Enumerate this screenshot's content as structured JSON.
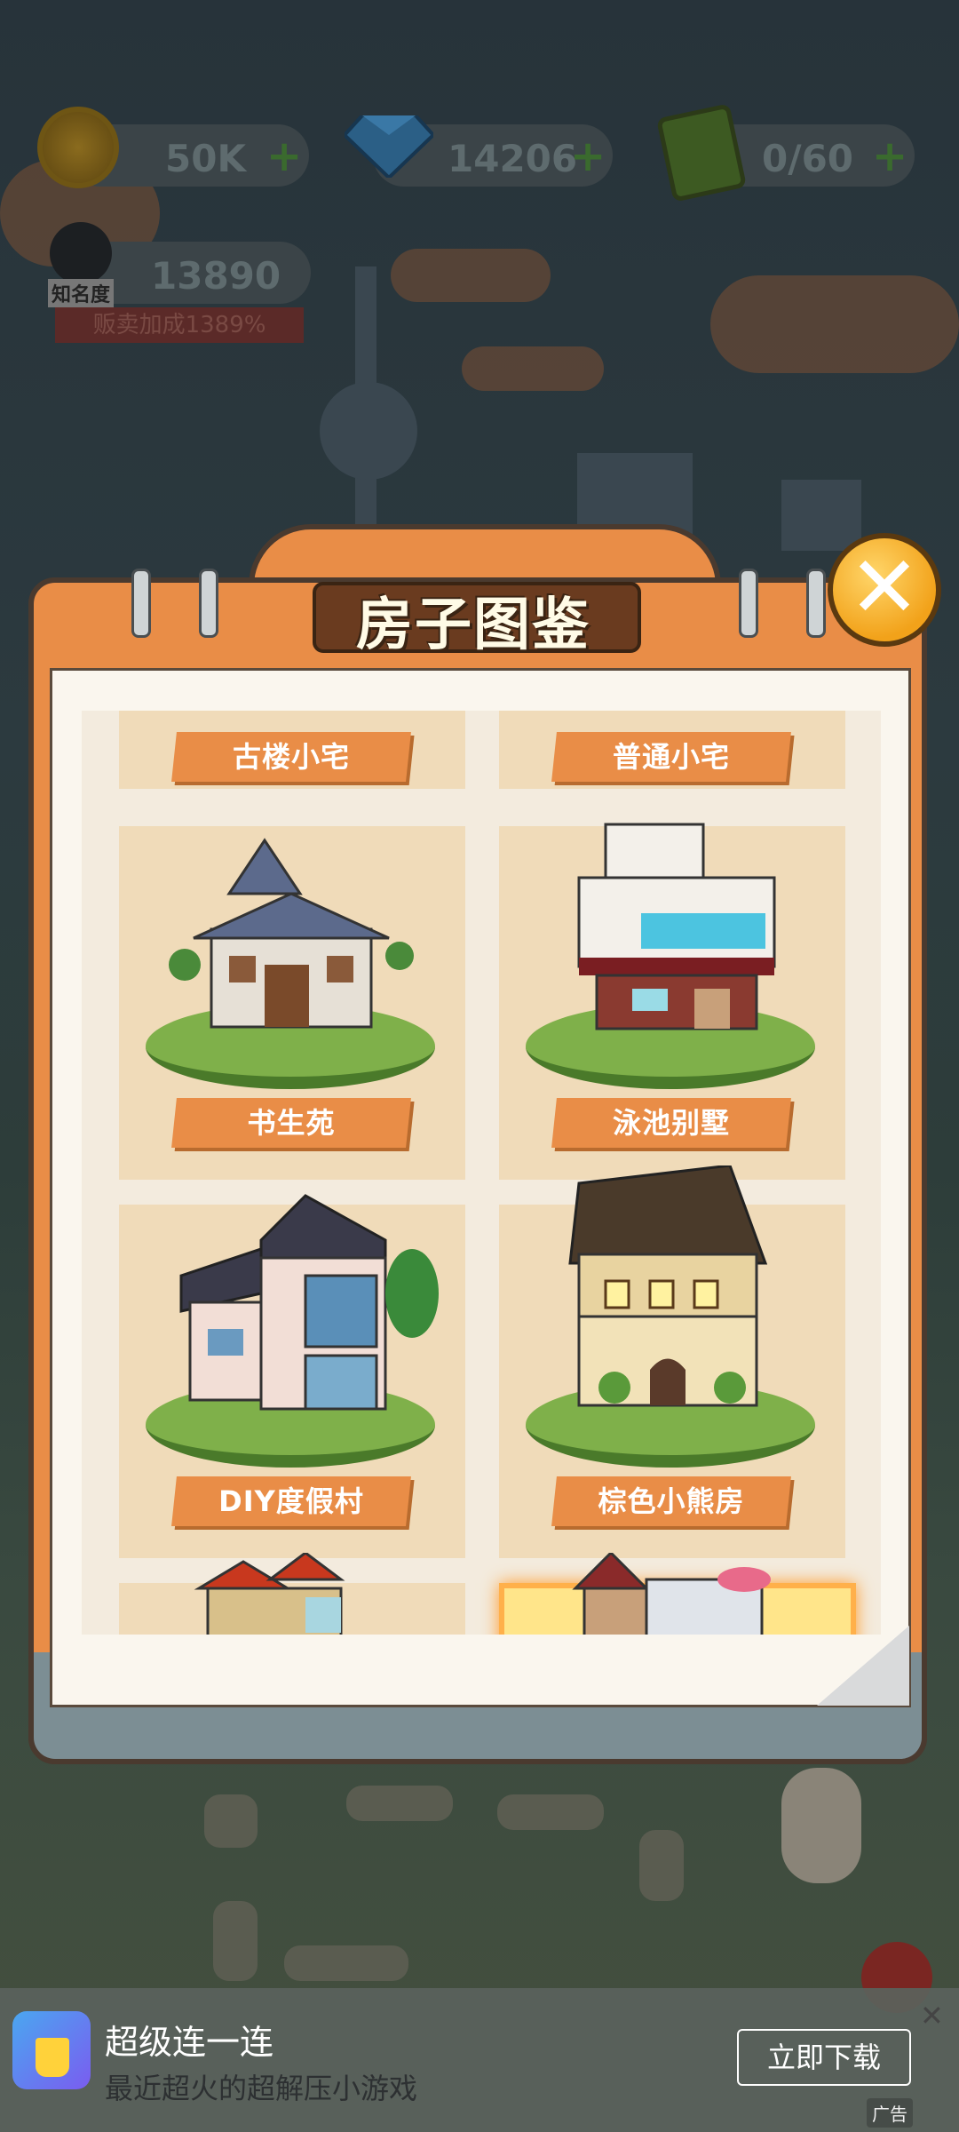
{
  "stats": {
    "coins": "50K",
    "gems": "14206",
    "energy": "0/60",
    "fame": "13890",
    "fame_label": "知名度",
    "sales_bonus": "贩卖加成1389%"
  },
  "dialog": {
    "title": "房子图鉴",
    "close_symbol": "✕"
  },
  "houses": [
    {
      "name": "古楼小宅"
    },
    {
      "name": "普通小宅"
    },
    {
      "name": "书生苑"
    },
    {
      "name": "泳池别墅"
    },
    {
      "name": "DIY度假村"
    },
    {
      "name": "棕色小熊房"
    }
  ],
  "ad": {
    "title": "超级连一连",
    "subtitle": "最近超火的超解压小游戏",
    "button": "立即下载",
    "close_symbol": "✕",
    "tag": "广告"
  },
  "colors": {
    "accent_orange": "#e98d47",
    "card_bg": "#f0dbb9",
    "close_yellow": "#f2a21a"
  }
}
